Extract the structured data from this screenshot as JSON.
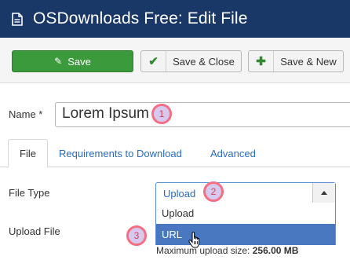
{
  "header": {
    "title": "OSDownloads Free: Edit File",
    "icon": "file-icon",
    "background": "#1a3867"
  },
  "toolbar": {
    "save_label": "Save",
    "save_close_label": "Save & Close",
    "save_new_label": "Save & New",
    "save_color": "#3b9a3b"
  },
  "form": {
    "name_label": "Name *",
    "name_value": "Lorem Ipsum",
    "file_type_label": "File Type",
    "file_type_value": "Upload",
    "file_type_options": [
      "Upload",
      "URL"
    ],
    "upload_file_label": "Upload File",
    "max_upload_prefix": "Maximum upload size: ",
    "max_upload_value": "256.00 MB"
  },
  "tabs": [
    {
      "label": "File",
      "active": true
    },
    {
      "label": "Requirements to Download",
      "active": false
    },
    {
      "label": "Advanced",
      "active": false
    }
  ],
  "markers": [
    "1",
    "2",
    "3"
  ]
}
